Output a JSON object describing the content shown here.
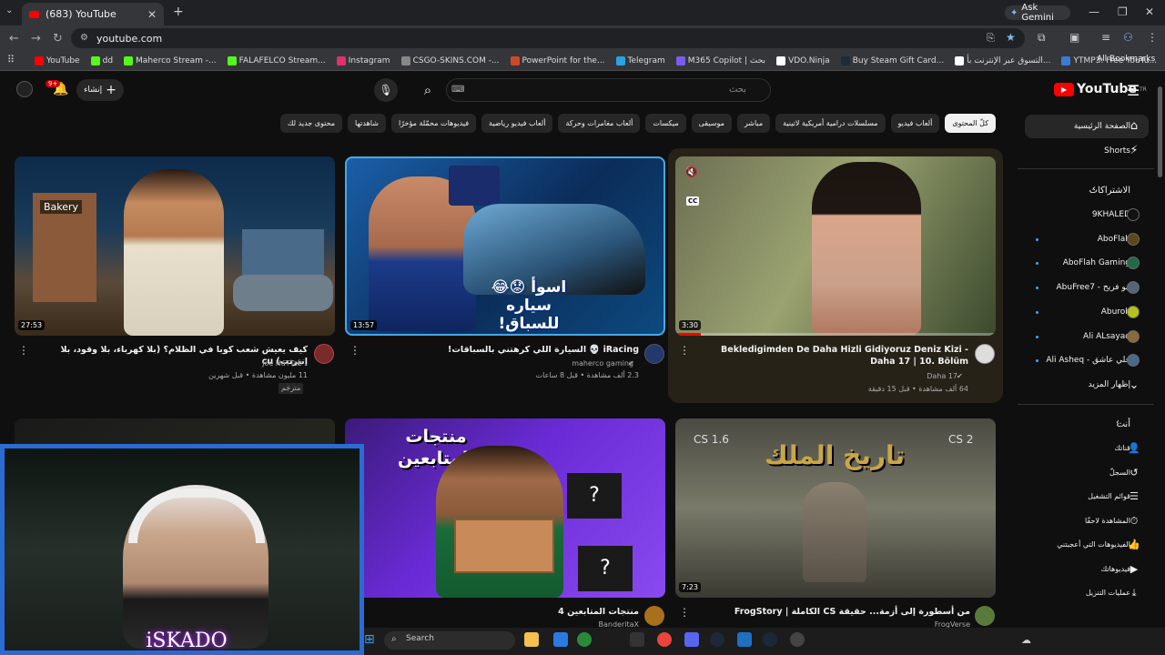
{
  "browser": {
    "tab_title": "(683) YouTube",
    "new_tab": "+",
    "ask_gemini": "Ask Gemini",
    "url": "youtube.com",
    "bookmarks": [
      {
        "label": "YouTube",
        "color": "#ff0000"
      },
      {
        "label": "dd",
        "color": "#53fc18"
      },
      {
        "label": "Maherco Stream -...",
        "color": "#53fc18"
      },
      {
        "label": "FALAFELCO Stream...",
        "color": "#53fc18"
      },
      {
        "label": "Instagram",
        "color": "#e1306c"
      },
      {
        "label": "CSGO-SKINS.COM -...",
        "color": "#888888"
      },
      {
        "label": "PowerPoint for the...",
        "color": "#d24726"
      },
      {
        "label": "Telegram",
        "color": "#2aa3e0"
      },
      {
        "label": "M365 Copilot | بحث",
        "color": "#7b5cf0"
      },
      {
        "label": "VDO.Ninja",
        "color": "#ffffff"
      },
      {
        "label": "Buy Steam Gift Card...",
        "color": "#1e2b38"
      },
      {
        "label": "التسوق عبر الإنترنت بأ...",
        "color": "#ffffff"
      },
      {
        "label": "YTMP3: Free YouTu...",
        "color": "#3a7bd5"
      }
    ],
    "all_bookmarks": "All Bookmarks"
  },
  "youtube": {
    "search_placeholder": "بحث",
    "create_label": "إنشاء",
    "notif_count": "9+",
    "logo_text": "YouTube",
    "logo_sup": "TR",
    "chips": [
      "كلّ المحتوى",
      "ألعاب فيديو",
      "مسلسلات درامية أمريكية لاتينية",
      "مباشر",
      "موسيقى",
      "ميكسات",
      "ألعاب مغامرات وحركة",
      "ألعاب فيديو رياضية",
      "فيديوهات محمّلة مؤخرًا",
      "شاهدتها",
      "محتوى جديد لك"
    ],
    "sidebar": {
      "home": "الصفحة الرئيسية",
      "shorts": "Shorts",
      "subscriptions": "الاشتراكات",
      "subs": [
        {
          "name": "9KHALED",
          "color": "#111111",
          "dot": false
        },
        {
          "name": "AboFlah",
          "color": "#5a4a1a",
          "dot": true
        },
        {
          "name": "AboFlah Gaming",
          "color": "#1e6b4a",
          "dot": true
        },
        {
          "name": "AbuFree7 - ابو فريح",
          "color": "#556677",
          "dot": true
        },
        {
          "name": "Aburob",
          "color": "#b5c21e",
          "dot": true
        },
        {
          "name": "Ali ALsayad",
          "color": "#8a6a3a",
          "dot": true
        },
        {
          "name": "Ali Asheq - علي عاشق",
          "color": "#4a6a8a",
          "dot": true
        }
      ],
      "show_more": "إظهار المزيد",
      "you": "أنت",
      "you_items": [
        "قناتك",
        "السجلّ",
        "قوائم التشغيل",
        "المشاهدة لاحقًا",
        "الفيديوهات التي أعجبتني",
        "فيديوهاتك",
        "عمليات التنزيل"
      ]
    },
    "videos": [
      {
        "title": "iRacing 💀 السيارة اللي كرهتني بالسباقات!",
        "channel": "maherco gaming",
        "views": "2.3 ألف مشاهدة • قبل 8 ساعات",
        "duration": "13:57",
        "thumb_text": "اسوأ 😟😂 سياره للسباق!"
      },
      {
        "title": "Bekledigimden De Daha Hizli Gidiyoruz Deniz Kizi - Daha 17 | 10. Bölüm",
        "channel": "Daha 17",
        "views": "64 ألف مشاهدة • قبل 15 دقيقة",
        "duration": "3:30",
        "thumb_text": "CC"
      },
      {
        "title": "كيف يعيش شعب كوبا في الظلام؟ (بلا كهرباء، بلا وقود، بلا إنترنت) cu",
        "channel": "Joe HaTTab",
        "views": "11 مليون مشاهدة • قبل شهرين",
        "duration": "27:53",
        "badge": "مترجَم",
        "thumb_text": "Bakery"
      },
      {
        "title": "منتجات المتابعين 4",
        "channel": "BanderitaX",
        "views": "",
        "duration": "10",
        "thumb_text": "منتجات المتابعين"
      },
      {
        "title": "من أسطورة إلى أزمة... حقيقة CS الكاملة | FrogStory",
        "channel": "FrogVerse",
        "views": "",
        "duration": "7:23",
        "thumb_text": "تاريخ الملك"
      }
    ]
  },
  "taskbar": {
    "search": "Search"
  },
  "webcam": {
    "label": "iSKADO"
  }
}
